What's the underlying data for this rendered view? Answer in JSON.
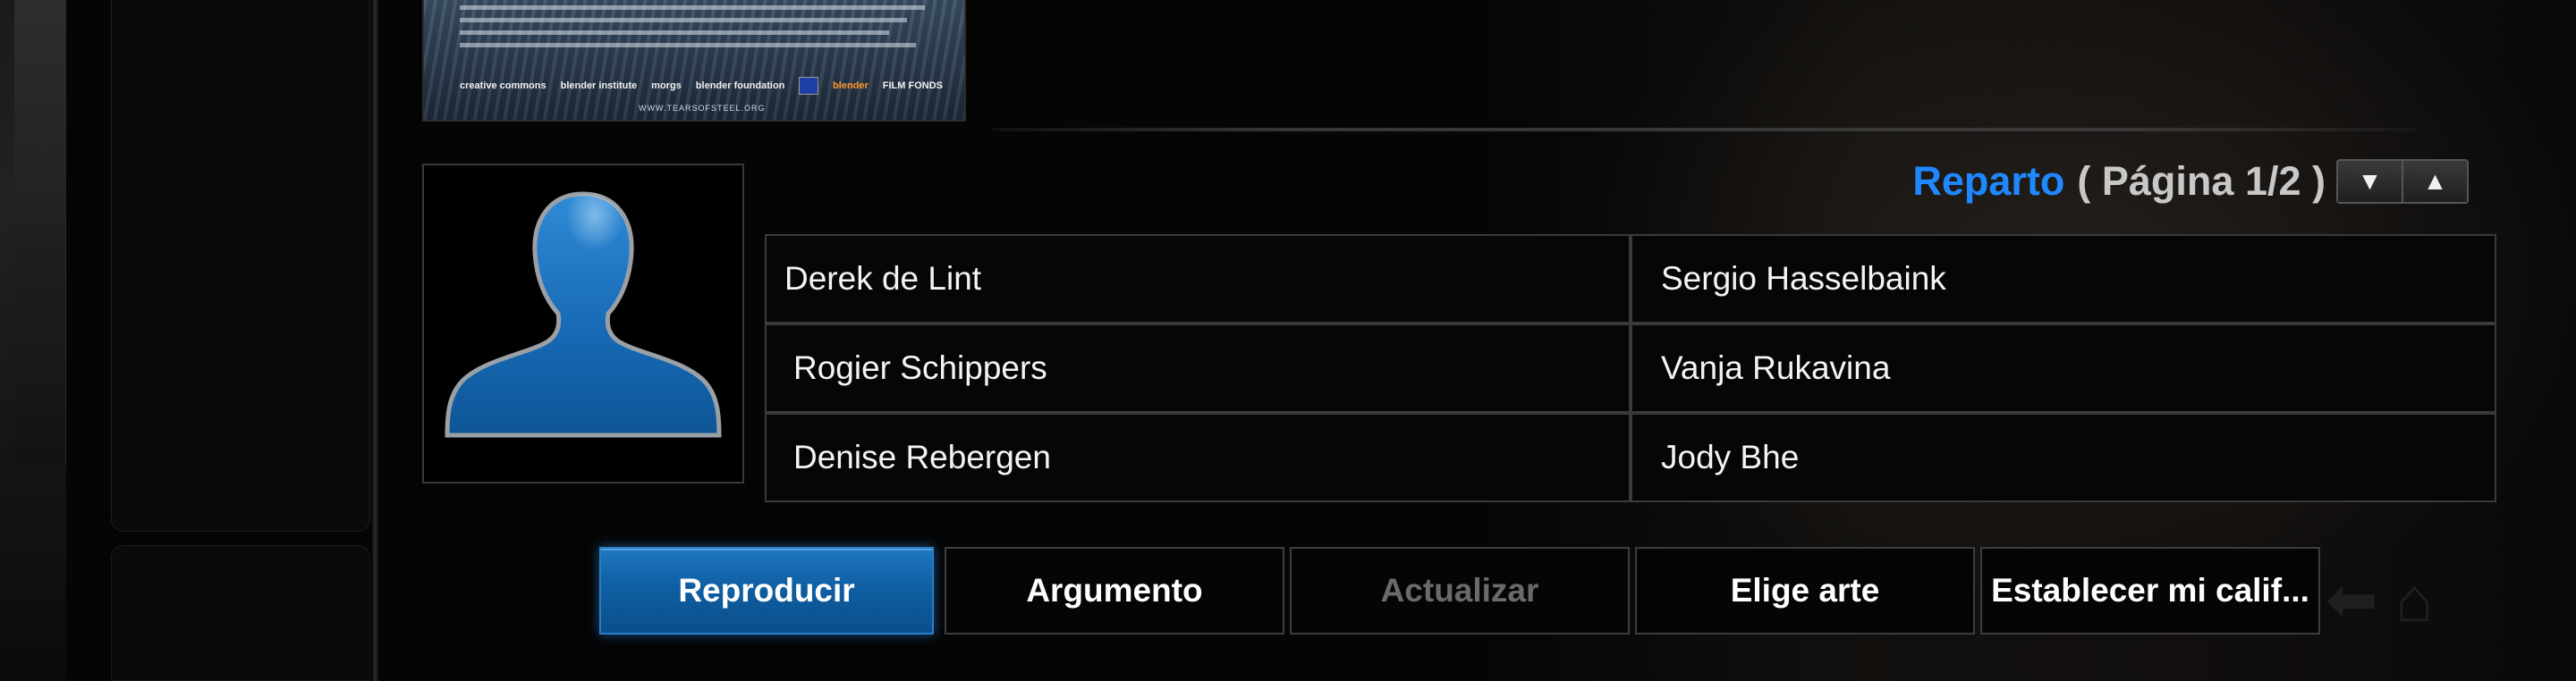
{
  "poster": {
    "logos": [
      "creative commons",
      "blender institute",
      "morgs",
      "blender foundation",
      "blender",
      "FILM FONDS"
    ],
    "url": "WWW.TEARSOFSTEEL.ORG"
  },
  "cast": {
    "title": "Reparto",
    "page_text": "( Página 1/2 )",
    "page_down_icon": "▼",
    "page_up_icon": "▲",
    "members": [
      "Derek de Lint",
      "Sergio Hasselbaink",
      "Rogier Schippers",
      "Vanja Rukavina",
      "Denise Rebergen",
      "Jody Bhe"
    ]
  },
  "actions": [
    {
      "label": "Reproducir",
      "state": "focused"
    },
    {
      "label": "Argumento",
      "state": "normal"
    },
    {
      "label": "Actualizar",
      "state": "disabled"
    },
    {
      "label": "Elige arte",
      "state": "normal"
    },
    {
      "label": "Establecer mi calif...",
      "state": "normal"
    }
  ],
  "colors": {
    "accent": "#1f88ff",
    "focus_button": "#0f5fa3",
    "disabled_text": "#6a6a6a"
  },
  "icons": {
    "default_actor": "silhouette-icon",
    "page_down": "triangle-down-icon",
    "page_up": "triangle-up-icon"
  }
}
